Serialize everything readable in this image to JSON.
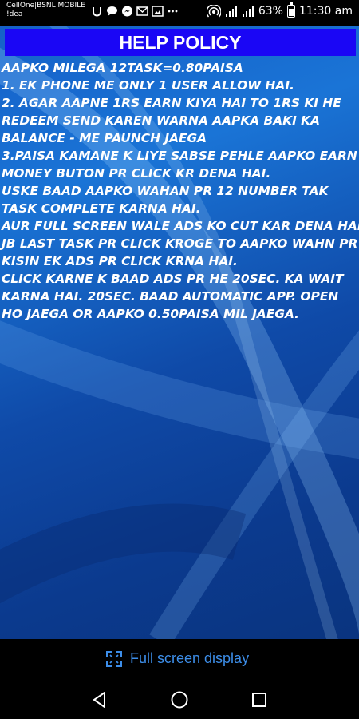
{
  "status_bar": {
    "carrier_line1": "CellOne|BSNL MOBILE",
    "carrier_line2": "!dea",
    "battery_percent": "63%",
    "time": "11:30 am"
  },
  "header": {
    "title": "HELP POLICY"
  },
  "policy_lines": [
    "AAPKO MILEGA 12TASK=0.80PAISA",
    "1. EK PHONE ME ONLY 1 USER ALLOW HAI.",
    "2. AGAR AAPNE 1RS EARN KIYA HAI TO 1RS KI HE",
    "REDEEM SEND KAREN WARNA AAPKA BAKI KA",
    "BALANCE - ME PAUNCH JAEGA",
    "3.PAISA KAMANE K LIYE SABSE PEHLE AAPKO EARN",
    "MONEY BUTON PR CLICK KR DENA HAI.",
    "USKE BAAD AAPKO WAHAN PR 12 NUMBER TAK",
    "TASK COMPLETE KARNA HAI.",
    "AUR FULL SCREEN WALE ADS KO CUT KAR DENA HAI",
    "JB LAST TASK PR CLICK KROGE TO AAPKO WAHN PR",
    "KISIN EK ADS PR CLICK KRNA HAI.",
    "CLICK KARNE K BAAD ADS PR HE 20SEC. KA WAIT",
    "KARNA HAI. 20SEC. BAAD AUTOMATIC APP. OPEN",
    "HO JAEGA OR AAPKO 0.50PAISA MIL JAEGA."
  ],
  "fullscreen": {
    "label": "Full screen display"
  },
  "icons": {
    "notifications": [
      "u-notification-icon",
      "chat-bubble-icon",
      "messenger-icon",
      "mail-icon",
      "gallery-icon",
      "more-dots-icon"
    ],
    "status": [
      "hotspot-icon",
      "signal-icon",
      "signal-icon-2",
      "battery-icon"
    ],
    "nav": [
      "back-icon",
      "home-icon",
      "recents-icon"
    ],
    "fullscreen": "expand-icon"
  },
  "colors": {
    "header_bg": "#1a06f5",
    "fullscreen_text": "#3d8ee9"
  }
}
